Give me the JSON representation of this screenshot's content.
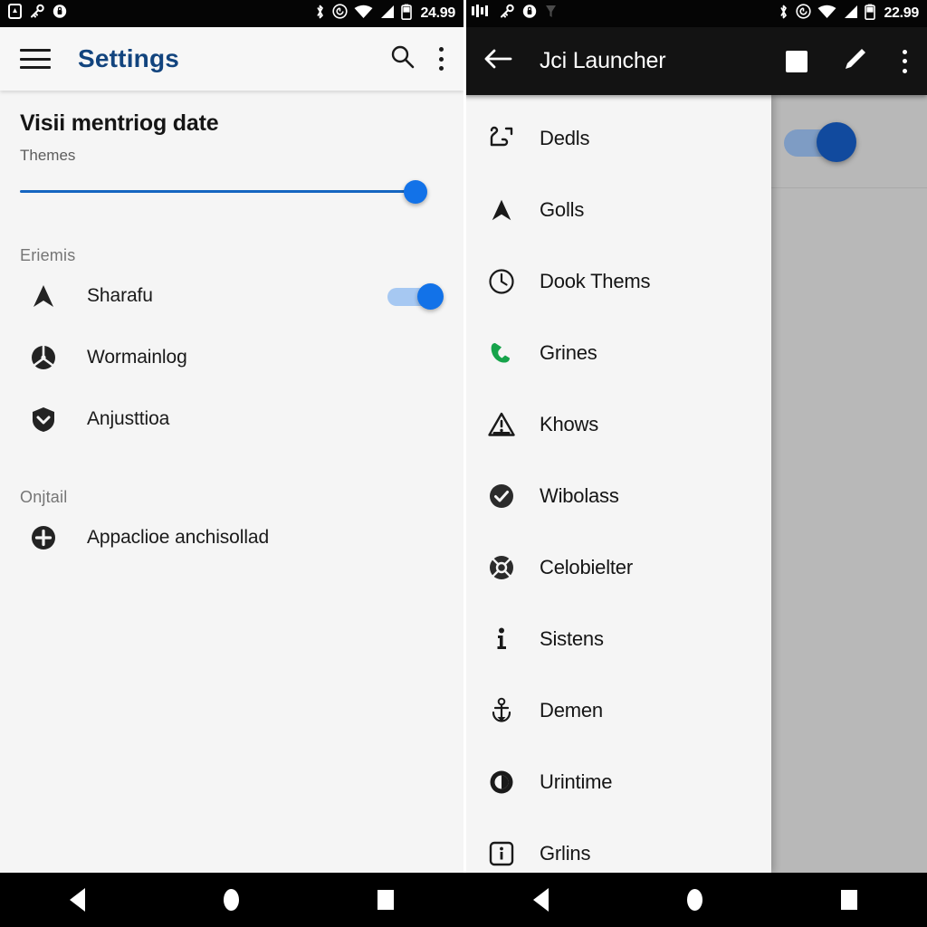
{
  "left_screen": {
    "status_bar": {
      "icons": [
        "sim-card-icon",
        "key-icon",
        "lock-badge-icon"
      ],
      "right_icons": [
        "bluetooth-icon",
        "sync-icon",
        "wifi-icon",
        "signal-icon",
        "battery-icon"
      ],
      "clock": "24.99"
    },
    "app_bar": {
      "menu_icon": "hamburger-menu-icon",
      "title": "Settings",
      "search_icon": "search-icon",
      "overflow_icon": "overflow-menu-icon"
    },
    "page_title": "Visii mentriog date",
    "slider": {
      "label": "Themes",
      "value": 100,
      "min": 0,
      "max": 100,
      "accent_color": "#1272e8"
    },
    "sections": [
      {
        "header": "Eriemis",
        "items": [
          {
            "icon": "navigation-arrow-icon",
            "label": "Sharafu",
            "has_toggle": true,
            "toggle_on": true
          },
          {
            "icon": "steering-wheel-icon",
            "label": "Wormainlog",
            "has_toggle": false
          },
          {
            "icon": "shield-chevron-icon",
            "label": "Anjusttioa",
            "has_toggle": false
          }
        ]
      },
      {
        "header": "Onjtail",
        "items": [
          {
            "icon": "plus-circle-icon",
            "label": "Appaclioe anchisollad",
            "has_toggle": false
          }
        ]
      }
    ],
    "nav_bar": {
      "back": "back-triangle-icon",
      "home": "home-circle-icon",
      "recents": "recents-square-icon"
    }
  },
  "right_screen": {
    "status_bar": {
      "icons": [
        "app-badge-icon",
        "key-icon",
        "lock-badge-icon",
        "download-icon"
      ],
      "right_icons": [
        "bluetooth-icon",
        "sync-icon",
        "wifi-icon",
        "signal-icon",
        "battery-icon"
      ],
      "clock": "22.99"
    },
    "app_bar": {
      "back_icon": "back-arrow-icon",
      "title": "Jci Launcher",
      "stop_icon": "stop-square-icon",
      "edit_icon": "pencil-edit-icon",
      "overflow_icon": "overflow-menu-icon"
    },
    "drawer_items": [
      {
        "icon": "route-path-icon",
        "label": "Dedls",
        "color": "#1a1a1a"
      },
      {
        "icon": "navigation-arrow-icon",
        "label": "Golls",
        "color": "#1a1a1a"
      },
      {
        "icon": "clock-icon",
        "label": "Dook Thems",
        "color": "#1a1a1a"
      },
      {
        "icon": "phone-call-icon",
        "label": "Grines",
        "color": "#16a34a"
      },
      {
        "icon": "warning-triangle-icon",
        "label": "Khows",
        "color": "#1a1a1a"
      },
      {
        "icon": "check-circle-icon",
        "label": "Wibolass",
        "color": "#1a1a1a"
      },
      {
        "icon": "lifebuoy-icon",
        "label": "Celobielter",
        "color": "#1a1a1a"
      },
      {
        "icon": "info-icon",
        "label": "Sistens",
        "color": "#1a1a1a"
      },
      {
        "icon": "anchor-icon",
        "label": "Demen",
        "color": "#1a1a1a"
      },
      {
        "icon": "pie-progress-icon",
        "label": "Urintime",
        "color": "#1a1a1a"
      },
      {
        "icon": "info-square-icon",
        "label": "Grlins",
        "color": "#1a1a1a"
      }
    ],
    "background_toggle": {
      "on": true,
      "color": "#114a9e"
    },
    "nav_bar": {
      "back": "back-triangle-icon",
      "home": "home-circle-icon",
      "recents": "recents-square-icon"
    }
  }
}
